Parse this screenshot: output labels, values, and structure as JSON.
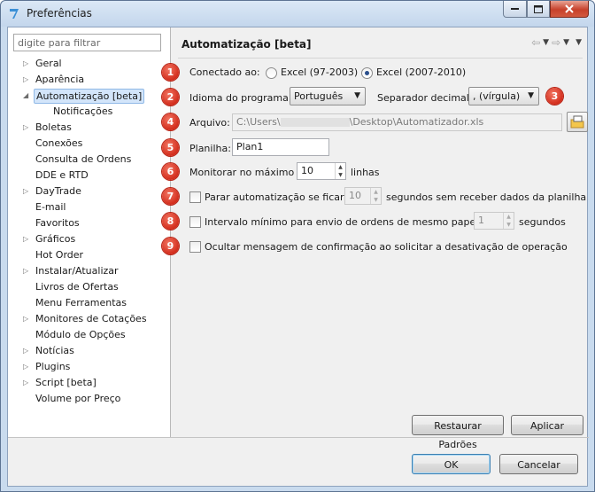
{
  "window": {
    "title": "Preferências",
    "icon": "app-logo-icon"
  },
  "filter": {
    "placeholder": "digite para filtrar"
  },
  "tree": [
    {
      "label": "Geral",
      "expandable": true
    },
    {
      "label": "Aparência",
      "expandable": true
    },
    {
      "label": "Automatização [beta]",
      "expandable": true,
      "expanded": true,
      "selected": true
    },
    {
      "label": "Notificações",
      "child": true
    },
    {
      "label": "Boletas",
      "expandable": true
    },
    {
      "label": "Conexões"
    },
    {
      "label": "Consulta de Ordens"
    },
    {
      "label": "DDE e RTD"
    },
    {
      "label": "DayTrade",
      "expandable": true
    },
    {
      "label": "E-mail"
    },
    {
      "label": "Favoritos"
    },
    {
      "label": "Gráficos",
      "expandable": true
    },
    {
      "label": "Hot Order"
    },
    {
      "label": "Instalar/Atualizar",
      "expandable": true
    },
    {
      "label": "Livros de Ofertas"
    },
    {
      "label": "Menu Ferramentas"
    },
    {
      "label": "Monitores de Cotações",
      "expandable": true
    },
    {
      "label": "Módulo de Opções"
    },
    {
      "label": "Notícias",
      "expandable": true
    },
    {
      "label": "Plugins",
      "expandable": true
    },
    {
      "label": "Script [beta]",
      "expandable": true
    },
    {
      "label": "Volume por Preço"
    }
  ],
  "pane": {
    "title": "Automatização [beta]"
  },
  "badges": [
    "1",
    "2",
    "3",
    "4",
    "5",
    "6",
    "7",
    "8",
    "9"
  ],
  "connected": {
    "label": "Conectado ao:",
    "option1": "Excel (97-2003)",
    "option2": "Excel (2007-2010)",
    "selected": "Excel (2007-2010)"
  },
  "language": {
    "label": "Idioma do programa:",
    "value": "Português"
  },
  "decimal": {
    "label": "Separador decimal:",
    "value": ", (vírgula)"
  },
  "file": {
    "label": "Arquivo:",
    "path_start": "C:\\Users\\",
    "path_end": "\\Desktop\\Automatizador.xls"
  },
  "sheet": {
    "label": "Planilha:",
    "value": "Plan1"
  },
  "monitor": {
    "label": "Monitorar no máximo",
    "value": "10",
    "suffix": "linhas"
  },
  "stop": {
    "label": "Parar automatização se ficar",
    "value": "10",
    "suffix": "segundos sem receber dados da planilha",
    "checked": false
  },
  "interval": {
    "label": "Intervalo mínimo para envio de ordens de mesmo papel:",
    "value": "1",
    "suffix": "segundos",
    "checked": false
  },
  "hide_confirm": {
    "label": "Ocultar mensagem de confirmação ao solicitar a desativação de operação",
    "checked": false
  },
  "buttons": {
    "restore": "Restaurar Padrões",
    "apply": "Aplicar",
    "ok": "OK",
    "cancel": "Cancelar"
  }
}
